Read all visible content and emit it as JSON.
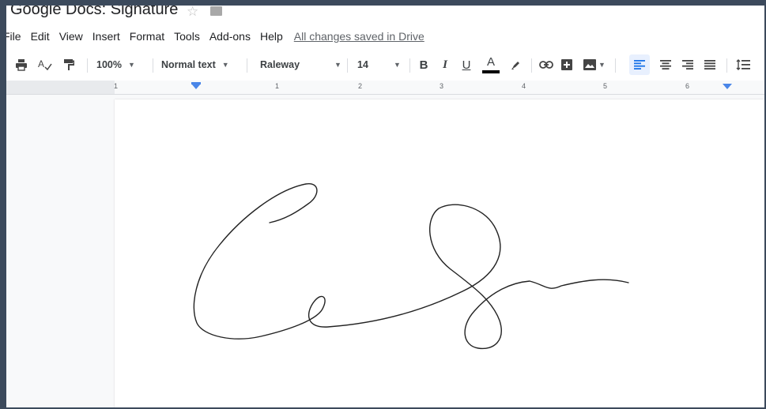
{
  "title_bar": {
    "doc_title": "Google Docs: Signature",
    "star_icon": "star-outline-icon",
    "folder_icon": "folder-icon"
  },
  "menu": {
    "items": [
      "File",
      "Edit",
      "View",
      "Insert",
      "Format",
      "Tools",
      "Add-ons",
      "Help"
    ],
    "saved_status": "All changes saved in Drive"
  },
  "toolbar": {
    "print_icon": "print-icon",
    "spellcheck_icon": "spellcheck-icon",
    "paint_format_icon": "paint-format-icon",
    "zoom": "100%",
    "style": "Normal text",
    "font": "Raleway",
    "font_size": "14",
    "bold": "B",
    "italic": "I",
    "underline": "U",
    "text_color": "A",
    "text_color_value": "#000000",
    "accent": "#1a73e8"
  },
  "ruler": {
    "labels": [
      "1",
      "1",
      "2",
      "3",
      "4",
      "5",
      "6"
    ]
  },
  "document": {
    "content": "handwritten-signature-drawing"
  }
}
